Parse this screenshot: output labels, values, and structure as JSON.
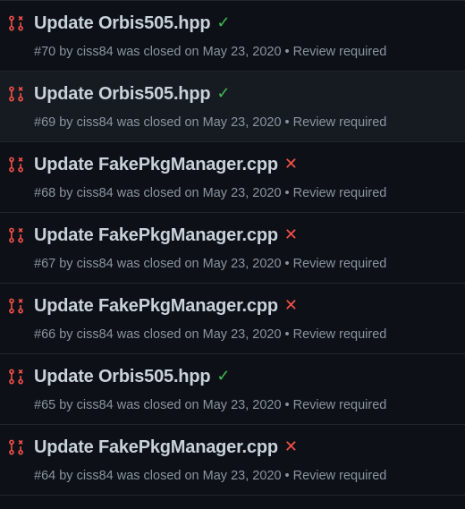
{
  "pull_requests": [
    {
      "title": "Update Orbis505.hpp",
      "status": "success",
      "status_glyph": "✓",
      "number": "#70",
      "by": "by",
      "author": "ciss84",
      "closed_text": "was closed on May 23, 2020",
      "separator": "•",
      "review": "Review required"
    },
    {
      "title": "Update Orbis505.hpp",
      "status": "success",
      "status_glyph": "✓",
      "number": "#69",
      "by": "by",
      "author": "ciss84",
      "closed_text": "was closed on May 23, 2020",
      "separator": "•",
      "review": "Review required"
    },
    {
      "title": "Update FakePkgManager.cpp",
      "status": "failure",
      "status_glyph": "✕",
      "number": "#68",
      "by": "by",
      "author": "ciss84",
      "closed_text": "was closed on May 23, 2020",
      "separator": "•",
      "review": "Review required"
    },
    {
      "title": "Update FakePkgManager.cpp",
      "status": "failure",
      "status_glyph": "✕",
      "number": "#67",
      "by": "by",
      "author": "ciss84",
      "closed_text": "was closed on May 23, 2020",
      "separator": "•",
      "review": "Review required"
    },
    {
      "title": "Update FakePkgManager.cpp",
      "status": "failure",
      "status_glyph": "✕",
      "number": "#66",
      "by": "by",
      "author": "ciss84",
      "closed_text": "was closed on May 23, 2020",
      "separator": "•",
      "review": "Review required"
    },
    {
      "title": "Update Orbis505.hpp",
      "status": "success",
      "status_glyph": "✓",
      "number": "#65",
      "by": "by",
      "author": "ciss84",
      "closed_text": "was closed on May 23, 2020",
      "separator": "•",
      "review": "Review required"
    },
    {
      "title": "Update FakePkgManager.cpp",
      "status": "failure",
      "status_glyph": "✕",
      "number": "#64",
      "by": "by",
      "author": "ciss84",
      "closed_text": "was closed on May 23, 2020",
      "separator": "•",
      "review": "Review required"
    }
  ],
  "hovered_index": 1,
  "colors": {
    "background": "#0d1117",
    "hover_background": "#161b22",
    "closed_pr_icon": "#f85149",
    "success": "#3fb950",
    "failure": "#f85149",
    "title": "#c9d1d9",
    "meta": "#8b949e"
  },
  "icons": {
    "row_icon": "git-pull-request-closed-icon",
    "success_icon": "check-icon",
    "failure_icon": "x-icon"
  }
}
